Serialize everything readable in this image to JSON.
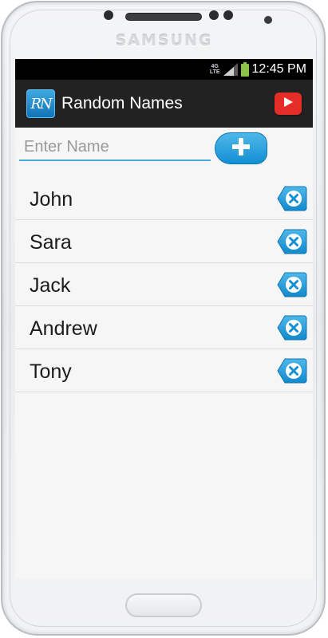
{
  "device": {
    "brand": "SAMSUNG"
  },
  "statusbar": {
    "network": "4G",
    "network_sub": "LTE",
    "time": "12:45 PM"
  },
  "actionbar": {
    "title": "Random Names",
    "app_icon_text": "RN",
    "youtube_icon": "youtube-play-icon"
  },
  "input": {
    "placeholder": "Enter Name",
    "value": "",
    "add_icon": "plus-icon"
  },
  "names": [
    {
      "label": "John",
      "delete_icon": "delete-backspace-icon"
    },
    {
      "label": "Sara",
      "delete_icon": "delete-backspace-icon"
    },
    {
      "label": "Jack",
      "delete_icon": "delete-backspace-icon"
    },
    {
      "label": "Andrew",
      "delete_icon": "delete-backspace-icon"
    },
    {
      "label": "Tony",
      "delete_icon": "delete-backspace-icon"
    }
  ],
  "colors": {
    "actionbar": "#222222",
    "accent": "#1a96d8",
    "youtube": "#e52d27",
    "battery": "#8bc34a"
  }
}
